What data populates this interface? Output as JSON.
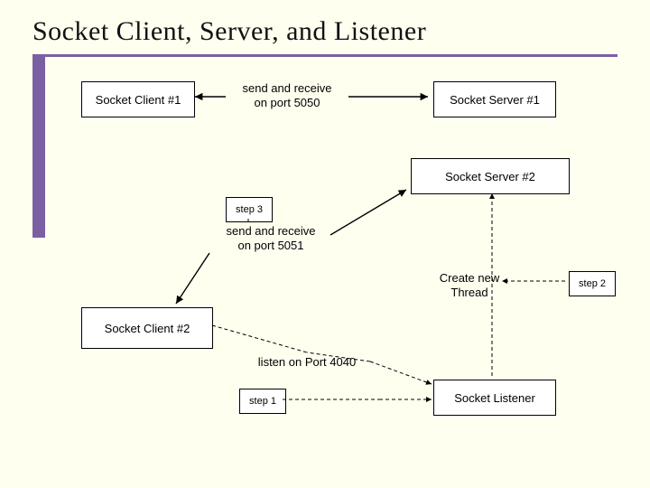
{
  "title": "Socket Client, Server, and Listener",
  "boxes": {
    "client1": "Socket Client #1",
    "server1": "Socket Server #1",
    "server2": "Socket Server #2",
    "client2": "Socket Client #2",
    "listener": "Socket Listener",
    "step1": "step 1",
    "step2": "step 2",
    "step3": "step 3"
  },
  "labels": {
    "conn1": "send and receive\non port 5050",
    "conn2": "send and receive\non port 5051",
    "listen": "listen on Port 4040",
    "newthread": "Create new\nThread"
  }
}
